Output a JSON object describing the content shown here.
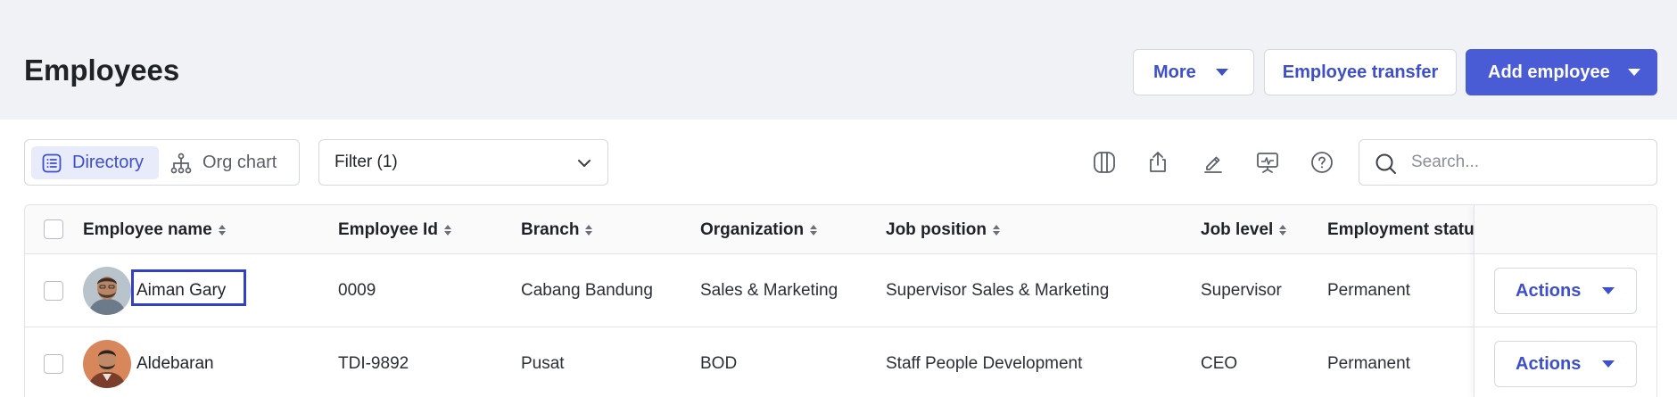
{
  "header": {
    "title": "Employees",
    "more_label": "More",
    "transfer_label": "Employee transfer",
    "add_label": "Add employee"
  },
  "toolbar": {
    "view_directory_label": "Directory",
    "view_org_label": "Org chart",
    "filter_label": "Filter (1)",
    "search_placeholder": "Search...",
    "icons": [
      "columns-icon",
      "export-icon",
      "edit-icon",
      "presentation-icon",
      "help-icon"
    ]
  },
  "table": {
    "columns": [
      "Employee name",
      "Employee Id",
      "Branch",
      "Organization",
      "Job position",
      "Job level",
      "Employment statu"
    ],
    "rows": [
      {
        "name": "Aiman Gary",
        "employee_id": "0009",
        "branch": "Cabang Bandung",
        "organization": "Sales & Marketing",
        "job_position": "Supervisor Sales & Marketing",
        "job_level": "Supervisor",
        "employment_status": "Permanent",
        "action_label": "Actions"
      },
      {
        "name": "Aldebaran",
        "employee_id": "TDI-9892",
        "branch": "Pusat",
        "organization": "BOD",
        "job_position": "Staff People Development",
        "job_level": "CEO",
        "employment_status": "Permanent",
        "action_label": "Actions"
      }
    ]
  },
  "colors": {
    "accent": "#4a5bd6",
    "link": "#3d4fc9",
    "header_bg": "#f1f2f6",
    "highlight_border": "#3340c4"
  }
}
